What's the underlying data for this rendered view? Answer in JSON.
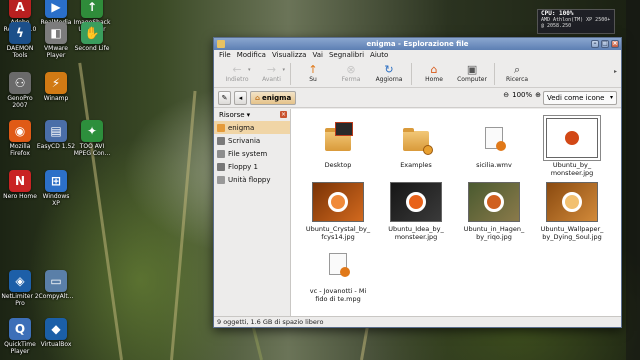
{
  "desktop": {
    "icons": [
      {
        "label": "Adobe\nReader 8.0",
        "icon": "pdf-reader-icon",
        "color": "#b82020",
        "glyph": "A"
      },
      {
        "label": "RealMedia\nplayer",
        "icon": "media-player-icon",
        "color": "#2a6fc9",
        "glyph": "▶"
      },
      {
        "label": "ImageShack\nUploader",
        "icon": "upload-icon",
        "color": "#2f8c3a",
        "glyph": "↑"
      },
      {
        "label": "DAEMON\nTools",
        "icon": "daemon-tools-icon",
        "color": "#1b4f8a",
        "glyph": "ϟ"
      },
      {
        "label": "VMware\nPlayer",
        "icon": "vmware-icon",
        "color": "#7c7c7c",
        "glyph": "◧"
      },
      {
        "label": "Second Life",
        "icon": "second-life-icon",
        "color": "#3a9d5d",
        "glyph": "✋"
      },
      {
        "label": "GenoPro\n2007",
        "icon": "genopro-icon",
        "color": "#6a6a6a",
        "glyph": "⚇"
      },
      {
        "label": "Winamp",
        "icon": "winamp-icon",
        "color": "#d17a14",
        "glyph": "⚡"
      },
      {
        "label": "Mozilla\nFirefox",
        "icon": "firefox-icon",
        "color": "#e05a16",
        "glyph": "◉"
      },
      {
        "label": "EasyCD 1.52",
        "icon": "easycd-icon",
        "color": "#4a6ea8",
        "glyph": "▤"
      },
      {
        "label": "TOO AVI\nMPEG Con...",
        "icon": "converter-icon",
        "color": "#2d8f3c",
        "glyph": "✦"
      },
      {
        "label": "Nero Home",
        "icon": "nero-icon",
        "color": "#c92323",
        "glyph": "N"
      },
      {
        "label": "Windows\nXP",
        "icon": "windows-icon",
        "color": "#2c70c8",
        "glyph": "⊞"
      },
      {
        "label": "NetLimiter 2\nPro",
        "icon": "netlimiter-icon",
        "color": "#1d5fa8",
        "glyph": "◈"
      },
      {
        "label": "CompyAlt...",
        "icon": "computer-icon",
        "color": "#5a7fa8",
        "glyph": "▭"
      },
      {
        "label": "QuickTime\nPlayer",
        "icon": "quicktime-icon",
        "color": "#3d6fb8",
        "glyph": "Q"
      },
      {
        "label": "VirtualBox",
        "icon": "virtualbox-icon",
        "color": "#1b5fa8",
        "glyph": "◆"
      }
    ],
    "sysmon": {
      "cpu": "CPU: 100%",
      "line1": "AMD Athlon(TM) XP 2500+",
      "line2": "@ 2058.250"
    }
  },
  "window": {
    "title": "enigma - Esplorazione file",
    "menu": [
      "File",
      "Modifica",
      "Visualizza",
      "Vai",
      "Segnalibri",
      "Aiuto"
    ],
    "toolbar": [
      {
        "label": "Indietro",
        "icon": "back-arrow-icon",
        "glyph": "←",
        "enabled": false
      },
      {
        "label": "Avanti",
        "icon": "forward-arrow-icon",
        "glyph": "→",
        "enabled": false
      },
      {
        "label": "Su",
        "icon": "up-arrow-icon",
        "glyph": "↑",
        "enabled": true,
        "color": "#e07818"
      },
      {
        "label": "Ferma",
        "icon": "stop-icon",
        "glyph": "⊗",
        "enabled": false
      },
      {
        "label": "Aggiorna",
        "icon": "refresh-icon",
        "glyph": "↻",
        "enabled": true,
        "color": "#2c6fc2"
      },
      {
        "label": "Home",
        "icon": "home-icon",
        "glyph": "⌂",
        "enabled": true,
        "color": "#d85a1a"
      },
      {
        "label": "Computer",
        "icon": "computer-icon",
        "glyph": "▣",
        "enabled": true,
        "color": "#555"
      },
      {
        "label": "Ricerca",
        "icon": "search-icon",
        "glyph": "⌕",
        "enabled": true,
        "color": "#444"
      }
    ],
    "location": {
      "current": "enigma",
      "zoom": "100%",
      "view_mode": "Vedi come icone"
    },
    "sidebar": {
      "header": "Risorse",
      "items": [
        {
          "label": "enigma",
          "icon": "home-folder-icon",
          "color": "#e59b3a",
          "selected": true
        },
        {
          "label": "Scrivania",
          "icon": "desktop-icon",
          "color": "#7a7a7a",
          "selected": false
        },
        {
          "label": "File system",
          "icon": "harddisk-icon",
          "color": "#8d8d8d",
          "selected": false
        },
        {
          "label": "Floppy 1",
          "icon": "floppy-icon",
          "color": "#777",
          "selected": false
        },
        {
          "label": "Unità floppy",
          "icon": "floppy-drive-icon",
          "color": "#999",
          "selected": false
        }
      ]
    },
    "files": [
      {
        "name": "Desktop",
        "kind": "folder"
      },
      {
        "name": "Examples",
        "kind": "folder"
      },
      {
        "name": "sicilia.wmv",
        "kind": "video"
      },
      {
        "name": "Ubuntu_by_\nmonsteer.jpg",
        "kind": "image",
        "colors": [
          "#ffffff",
          "#ffffff",
          "#d24816"
        ],
        "selected": true
      },
      {
        "name": "Ubuntu_Crystal_by_\nfcys14.jpg",
        "kind": "image",
        "colors": [
          "#7a3306",
          "#d2691e",
          "#f08a3a"
        ]
      },
      {
        "name": "Ubuntu_Idea_by_\nmonsteer.jpg",
        "kind": "image",
        "colors": [
          "#161616",
          "#3a3a3a",
          "#e8621a"
        ]
      },
      {
        "name": "Ubuntu_in_Hagen_\nby_riqo.jpg",
        "kind": "image",
        "colors": [
          "#4a5a30",
          "#8a7a4a",
          "#d06020"
        ]
      },
      {
        "name": "Ubuntu_Wallpaper_\nby_Dying_Soul.jpg",
        "kind": "image",
        "colors": [
          "#8a4a10",
          "#d28a3a",
          "#f2c070"
        ]
      },
      {
        "name": "vc - Jovanotti - Mi\nfido di te.mpg",
        "kind": "video"
      }
    ],
    "status": "9 oggetti, 1.6 GB di spazio libero"
  }
}
